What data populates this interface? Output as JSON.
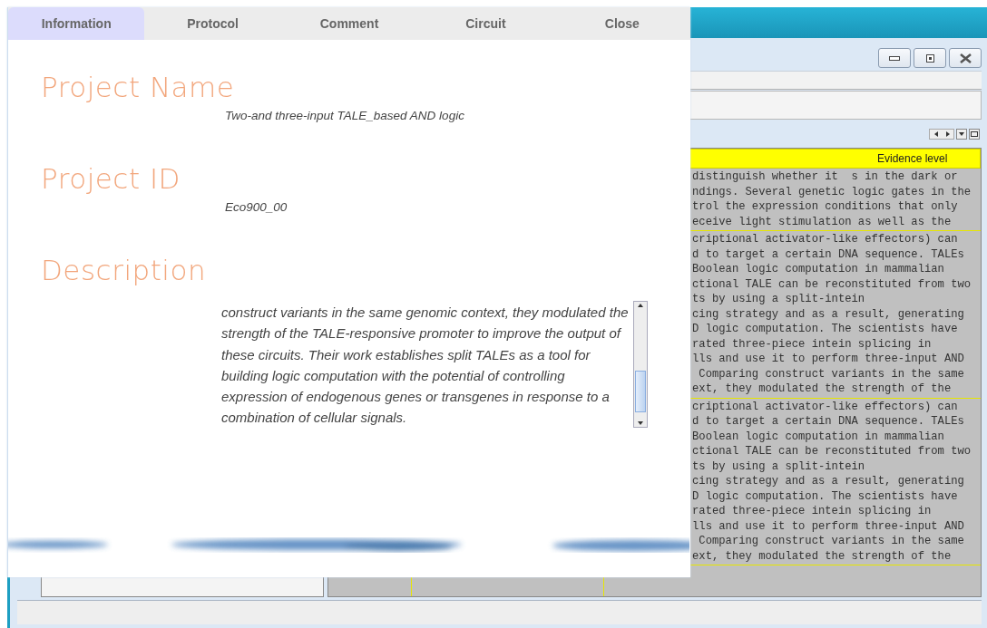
{
  "dialog": {
    "tabs": [
      {
        "label": "Information",
        "selected": true
      },
      {
        "label": "Protocol",
        "selected": false
      },
      {
        "label": "Comment",
        "selected": false
      },
      {
        "label": "Circuit",
        "selected": false
      },
      {
        "label": "Close",
        "selected": false
      }
    ],
    "fields": [
      {
        "kind": "text",
        "label": "Project Name",
        "value": "Two-and three-input TALE_based AND logic"
      },
      {
        "kind": "text",
        "label": "Project ID",
        "value": "Eco900_00"
      },
      {
        "kind": "scroll",
        "label": "Description",
        "value": "construct variants in the same genomic context, they modulated the strength of the TALE-responsive promoter to improve the output of these circuits. Their work establishes split TALEs as a tool for building logic computation with the potential of controlling expression of endogenous genes or transgenes in response to a combination of cellular signals."
      }
    ]
  },
  "table": {
    "header": "Evidence level",
    "rows": [
      {
        "lines": [
          "distinguish whether it  s in the dark or",
          "ndings. Several genetic logic gates in the",
          "trol the expression conditions that only",
          "eceive light stimulation as well as the"
        ]
      },
      {
        "lines": [
          "criptional activator-like effectors) can",
          "d to target a certain DNA sequence. TALEs",
          "Boolean logic computation in mammalian",
          "ctional TALE can be reconstituted from two",
          "ts by using a split-intein",
          "cing strategy and as a result, generating",
          "D logic computation. The scientists have",
          "rated three-piece intein splicing in",
          "lls and use it to perform three-input AND",
          " Comparing construct variants in the same",
          "ext, they modulated the strength of the"
        ]
      },
      {
        "lines": [
          "criptional activator-like effectors) can",
          "d to target a certain DNA sequence. TALEs",
          "Boolean logic computation in mammalian",
          "ctional TALE can be reconstituted from two",
          "ts by using a split-intein",
          "cing strategy and as a result, generating",
          "D logic computation. The scientists have",
          "rated three-piece intein splicing in",
          "lls and use it to perform three-input AND",
          " Comparing construct variants in the same",
          "ext, they modulated the strength of the"
        ]
      }
    ]
  }
}
